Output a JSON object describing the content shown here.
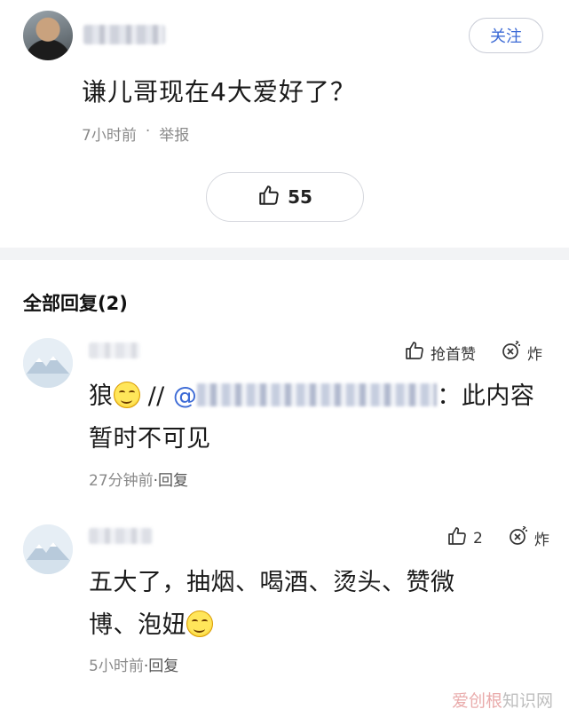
{
  "post": {
    "follow_label": "关注",
    "text": "谦儿哥现在4大爱好了？",
    "time": "7小时前",
    "separator": "·",
    "report_label": "举报",
    "like_count": "55"
  },
  "replies_section": {
    "title": "全部回复(2)",
    "replies": [
      {
        "like_label": "抢首赞",
        "bomb_label": "炸",
        "text_prefix": "狼",
        "forward_sep": " // ",
        "mention_at": "@",
        "text_suffix": "：此内容",
        "text_line2": "暂时不可见",
        "time": "27分钟前",
        "reply_label": "·回复"
      },
      {
        "like_count": "2",
        "bomb_label": "炸",
        "text_line1": "五大了，抽烟、喝酒、烫头、赞微",
        "text_line2": "博、泡妞",
        "time": "5小时前",
        "reply_label": "·回复"
      }
    ]
  },
  "watermark": {
    "accent": "爱创根",
    "text": "知识网"
  },
  "colors": {
    "link": "#3d6bd6",
    "meta": "#8a8a8a",
    "divider": "#f2f3f5"
  }
}
